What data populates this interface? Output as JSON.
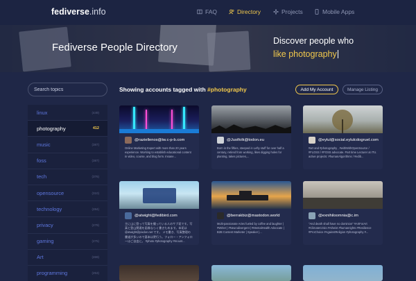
{
  "nav": {
    "logo_main": "fediverse",
    "logo_tld": ".info",
    "items": [
      {
        "label": "FAQ",
        "icon": "book-icon",
        "active": false
      },
      {
        "label": "Directory",
        "icon": "users-icon",
        "active": true
      },
      {
        "label": "Projects",
        "icon": "sparkle-icon",
        "active": false
      },
      {
        "label": "Mobile Apps",
        "icon": "phone-icon",
        "active": false
      }
    ]
  },
  "hero": {
    "title": "Fediverse People Directory",
    "tagline_line1": "Discover people who",
    "tagline_highlight": "like photography"
  },
  "sidebar": {
    "search_placeholder": "Search topics",
    "topics": [
      {
        "name": "linux",
        "count": "(449)"
      },
      {
        "name": "photography",
        "count": "412",
        "active": true
      },
      {
        "name": "music",
        "count": "(387)"
      },
      {
        "name": "foss",
        "count": "(387)"
      },
      {
        "name": "tech",
        "count": "(376)"
      },
      {
        "name": "opensource",
        "count": "(310)"
      },
      {
        "name": "technology",
        "count": "(284)"
      },
      {
        "name": "privacy",
        "count": "(279)"
      },
      {
        "name": "gaming",
        "count": "(275)"
      },
      {
        "name": "Art",
        "count": "(269)"
      },
      {
        "name": "programming",
        "count": "(253)"
      }
    ]
  },
  "main": {
    "heading_prefix": "Showing accounts tagged with",
    "heading_tag": "#photography",
    "add_button": "Add My Account",
    "manage_button": "Manage Listing",
    "cards": [
      {
        "handle": "@raziellenos@tw.c-p-b.com",
        "bio": "Online Marketing Expert with more than 20 years experience. Working to establish educational content in video, course, and blog form. Insane..."
      },
      {
        "handle": "@Justfolk@todon.eu",
        "bio": "Born in the fifties, steeped in Lefty stuff for over half a century, retired from working, likes digging holes for planting, takes pictures,..."
      },
      {
        "handle": "@eylul@social.eylulcdogruel.com",
        "bio": "#art and #photography , #withWithOpenSource / #FLOSS / #FOSS advocate. Part time Lecturer at ITU. active projects: #humanAlgorithms / #edib..."
      },
      {
        "handle": "@atwight@fedibird.com",
        "bio": "主に山に登って写真を撮っている人のサブ垢です。写真と登山関連を画像ならく書きためます。本垢は @atwight@pixdon.net です。 メモ書き、写真整理の書道が多いので基本は更行う。フォロー・アンフォローはご自由に。 #photo #photography #mount..."
      },
      {
        "handle": "@berrakbiz@mastodon.world",
        "bio": "Multi-passionate Aries fueled by coffee and laughter | #Writer | #Neurodivergent | #MentalHealth Advocate | B2B Content Marketer | Speaker |..."
      },
      {
        "handle": "@exnihiloomnia@c.im",
        "bio": "\"And death shall have no dominion\" #ArtForArt #ClimateCrisis #Atheist #humanrights #Resilience #ProChoice #AgainstReligion #photography #..."
      },
      {
        "handle": "",
        "bio": ""
      },
      {
        "handle": "",
        "bio": ""
      },
      {
        "handle": "",
        "bio": ""
      }
    ]
  },
  "colors": {
    "accent": "#f2c94c",
    "link": "#5f78e0",
    "background": "#1f2747"
  }
}
